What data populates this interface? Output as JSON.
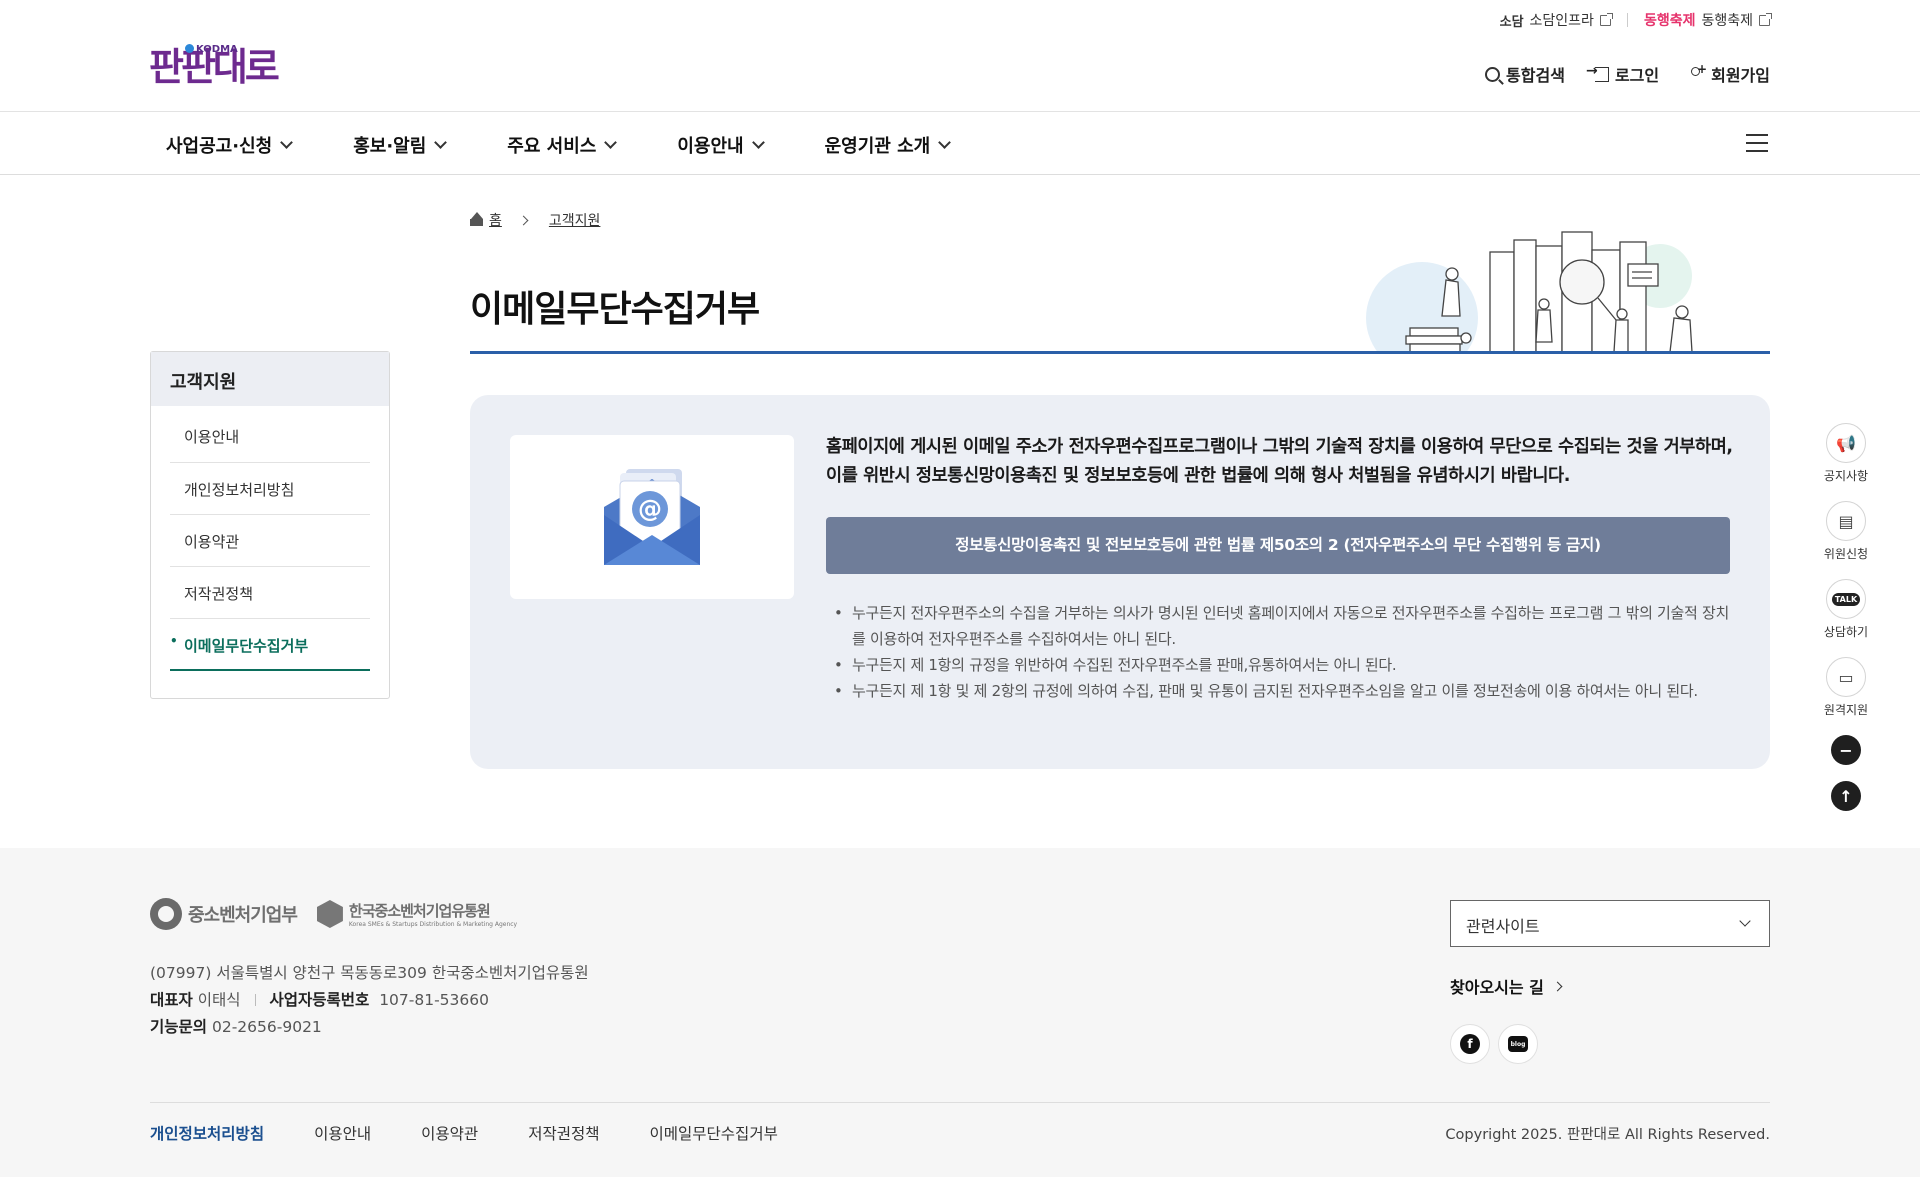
{
  "util_links": [
    {
      "brand": "소담",
      "label": "소담인프라"
    },
    {
      "brand": "동행축제",
      "label": "동행축제"
    }
  ],
  "logo": {
    "text": "판판대로",
    "sub": "KODMA"
  },
  "header_actions": {
    "search": "통합검색",
    "login": "로그인",
    "join": "회원가입"
  },
  "nav": [
    "사업공고·신청",
    "홍보·알림",
    "주요 서비스",
    "이용안내",
    "운영기관 소개"
  ],
  "sidebar": {
    "title": "고객지원",
    "items": [
      "이용안내",
      "개인정보처리방침",
      "이용약관",
      "저작권정책",
      "이메일무단수집거부"
    ],
    "active_index": 4
  },
  "breadcrumb": {
    "home": "홈",
    "current": "고객지원"
  },
  "page_title": "이메일무단수집거부",
  "content": {
    "description": "홈페이지에 게시된 이메일 주소가 전자우편수집프로그램이나 그밖의 기술적 장치를 이용하여 무단으로 수집되는 것을 거부하며, 이를 위반시 정보통신망이용촉진 및 정보보호등에 관한 법률에 의해 형사 처벌됨을 유념하시기 바랍니다.",
    "law_title": "정보통신망이용촉진 및 전보보호등에 관한 법률 제50조의 2 (전자우편주소의 무단 수집행위 등 금지)",
    "bullets": [
      "누구든지 전자우편주소의 수집을 거부하는 의사가 명시된 인터넷 홈페이지에서 자동으로 전자우편주소를 수집하는 프로그램 그 밖의 기술적 장치를 이용하여 전자우편주소를 수집하여서는 아니 된다.",
      "누구든지 제 1항의 규정을 위반하여 수집된 전자우편주소를 판매,유통하여서는 아니 된다.",
      "누구든지 제 1항 및 제 2항의 규정에 의하여 수집, 판매 및 유통이 금지된 전자우편주소임을 알고 이를 정보전송에 이용 하여서는 아니 된다."
    ]
  },
  "quick_menu": [
    "공지사항",
    "위원신청",
    "상담하기",
    "원격지원"
  ],
  "quick_icons": {
    "talk": "TALK"
  },
  "footer": {
    "logo1": "중소벤처기업부",
    "logo2": "한국중소벤처기업유통원",
    "logo2_sub": "Korea SMEs & Startups Distribution & Marketing Agency",
    "address": "(07997) 서울특별시 양천구 목동동로309 한국중소벤처기업유통원",
    "ceo_label": "대표자",
    "ceo": "이태식",
    "bizno_label": "사업자등록번호",
    "bizno": "107-81-53660",
    "tel_label": "기능문의",
    "tel": "02-2656-9021",
    "related_sites": "관련사이트",
    "directions": "찾아오시는 길",
    "sns": {
      "facebook": "f",
      "blog": "blog"
    },
    "links": [
      "개인정보처리방침",
      "이용안내",
      "이용약관",
      "저작권정책",
      "이메일무단수집거부"
    ],
    "copyright": "Copyright 2025. 판판대로 All Rights Reserved."
  },
  "colors": {
    "accent": "#2a5fa8",
    "active": "#0b6e5c",
    "banner": "#6f7d99",
    "logo": "#6d2a8f"
  }
}
